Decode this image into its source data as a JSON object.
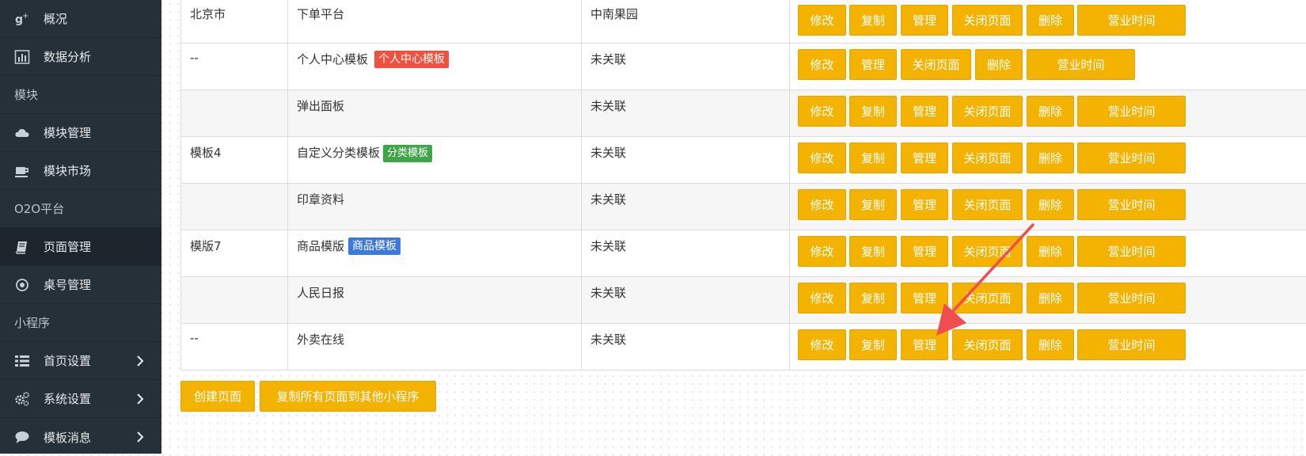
{
  "sidebar": {
    "items": [
      {
        "label": "概况",
        "icon": "google-plus-icon"
      },
      {
        "label": "数据分析",
        "icon": "bar-chart-icon"
      },
      {
        "section": "模块"
      },
      {
        "label": "模块管理",
        "icon": "cloud-icon"
      },
      {
        "label": "模块市场",
        "icon": "coffee-cup-icon"
      },
      {
        "section": "O2O平台"
      },
      {
        "label": "页面管理",
        "icon": "book-icon",
        "active": true
      },
      {
        "label": "桌号管理",
        "icon": "circle-dot-icon"
      },
      {
        "section": "小程序"
      },
      {
        "label": "首页设置",
        "icon": "list-icon",
        "arrow": true
      },
      {
        "label": "系统设置",
        "icon": "gears-icon",
        "arrow": true
      },
      {
        "label": "模板消息",
        "icon": "chat-bubble-icon",
        "arrow": true
      }
    ]
  },
  "table": {
    "rows": [
      {
        "col1": "北京市",
        "name": "下单平台",
        "tag": "",
        "relation": "中南果园",
        "buttons": [
          "修改",
          "复制",
          "管理",
          "关闭页面",
          "删除",
          "营业时间"
        ]
      },
      {
        "col1": "--",
        "name": "个人中心模板",
        "tag": "个人中心模板",
        "tag_color": "red",
        "relation": "未关联",
        "buttons": [
          "修改",
          "管理",
          "关闭页面",
          "删除",
          "营业时间"
        ]
      },
      {
        "col1": "",
        "name": "弹出面板",
        "tag": "",
        "relation": "未关联",
        "buttons": [
          "修改",
          "复制",
          "管理",
          "关闭页面",
          "删除",
          "营业时间"
        ]
      },
      {
        "col1": "模板4",
        "name": "自定义分类模板",
        "tag": "分类模板",
        "tag_color": "green",
        "relation": "未关联",
        "buttons": [
          "修改",
          "复制",
          "管理",
          "关闭页面",
          "删除",
          "营业时间"
        ]
      },
      {
        "col1": "",
        "name": "印章资料",
        "tag": "",
        "relation": "未关联",
        "buttons": [
          "修改",
          "复制",
          "管理",
          "关闭页面",
          "删除",
          "营业时间"
        ]
      },
      {
        "col1": "模版7",
        "name": "商品模版",
        "tag": "商品模板",
        "tag_color": "blue",
        "relation": "未关联",
        "buttons": [
          "修改",
          "复制",
          "管理",
          "关闭页面",
          "删除",
          "营业时间"
        ]
      },
      {
        "col1": "",
        "name": "人民日报",
        "tag": "",
        "relation": "未关联",
        "buttons": [
          "修改",
          "复制",
          "管理",
          "关闭页面",
          "删除",
          "营业时间"
        ]
      },
      {
        "col1": "--",
        "name": "外卖在线",
        "tag": "",
        "relation": "未关联",
        "buttons": [
          "修改",
          "复制",
          "管理",
          "关闭页面",
          "删除",
          "营业时间"
        ]
      }
    ]
  },
  "footer": {
    "create_page": "创建页面",
    "copy_all": "复制所有页面到其他小程序"
  },
  "colors": {
    "button": "#f5b301",
    "sidebar": "#253038",
    "arrow": "#f04e4e"
  }
}
